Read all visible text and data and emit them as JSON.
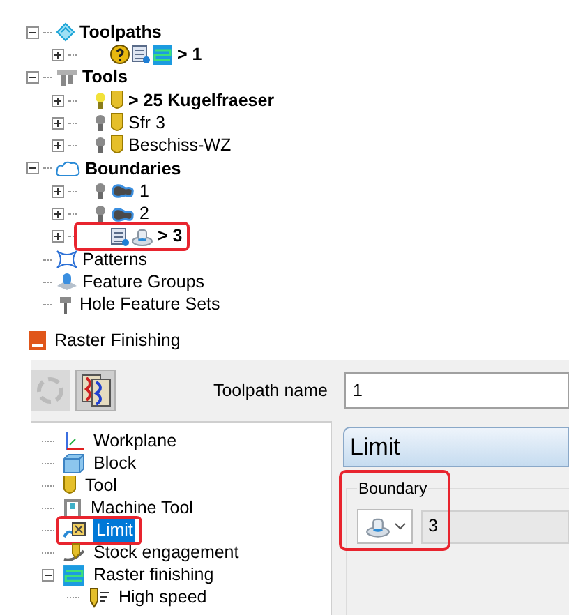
{
  "explorer": {
    "items": [
      {
        "label": "Toolpaths",
        "kind": "toolpaths",
        "active": true,
        "expanded": true,
        "children": [
          {
            "label": "> 1",
            "kind": "toolpath",
            "active": true,
            "expanded": false,
            "highlighted": false
          }
        ]
      },
      {
        "label": "Tools",
        "kind": "tools",
        "active": true,
        "expanded": true,
        "children": [
          {
            "label": "> 25 Kugelfraeser",
            "kind": "tool",
            "active": true,
            "expanded": false,
            "visible": true,
            "highlighted": false
          },
          {
            "label": "Sfr 3",
            "kind": "tool",
            "active": false,
            "expanded": false,
            "visible": false,
            "highlighted": false
          },
          {
            "label": "Beschiss-WZ",
            "kind": "tool",
            "active": false,
            "expanded": false,
            "visible": false,
            "highlighted": false
          }
        ]
      },
      {
        "label": "Boundaries",
        "kind": "boundaries",
        "active": true,
        "expanded": true,
        "children": [
          {
            "label": "1",
            "kind": "boundary",
            "active": false,
            "expanded": false,
            "visible": false,
            "highlighted": false
          },
          {
            "label": "2",
            "kind": "boundary",
            "active": false,
            "expanded": false,
            "visible": false,
            "highlighted": false
          },
          {
            "label": "> 3",
            "kind": "user-boundary",
            "active": true,
            "expanded": false,
            "highlighted": true
          }
        ]
      },
      {
        "label": "Patterns",
        "kind": "patterns",
        "active": false
      },
      {
        "label": "Feature Groups",
        "kind": "feature-groups",
        "active": false
      },
      {
        "label": "Hole Feature Sets",
        "kind": "hole-sets",
        "active": false
      }
    ]
  },
  "dialog": {
    "title": "Raster Finishing",
    "toolpath_name": {
      "label": "Toolpath name",
      "value": "1"
    },
    "pages": [
      {
        "label": "Workplane",
        "kind": "workplane",
        "selected": false,
        "highlighted": false
      },
      {
        "label": "Block",
        "kind": "block",
        "selected": false,
        "highlighted": false
      },
      {
        "label": "Tool",
        "kind": "tool",
        "selected": false,
        "highlighted": false
      },
      {
        "label": "Machine Tool",
        "kind": "machine",
        "selected": false,
        "highlighted": false
      },
      {
        "label": "Limit",
        "kind": "limit",
        "selected": true,
        "highlighted": true
      },
      {
        "label": "Stock engagement",
        "kind": "stock",
        "selected": false,
        "highlighted": false
      },
      {
        "label": "Raster finishing",
        "kind": "raster",
        "selected": false,
        "highlighted": false,
        "expanded": true,
        "children": [
          {
            "label": "High speed",
            "kind": "speed",
            "selected": false,
            "highlighted": false
          }
        ]
      }
    ],
    "page_title": "Limit",
    "boundary": {
      "label": "Boundary",
      "value": "3",
      "highlighted": true
    }
  }
}
